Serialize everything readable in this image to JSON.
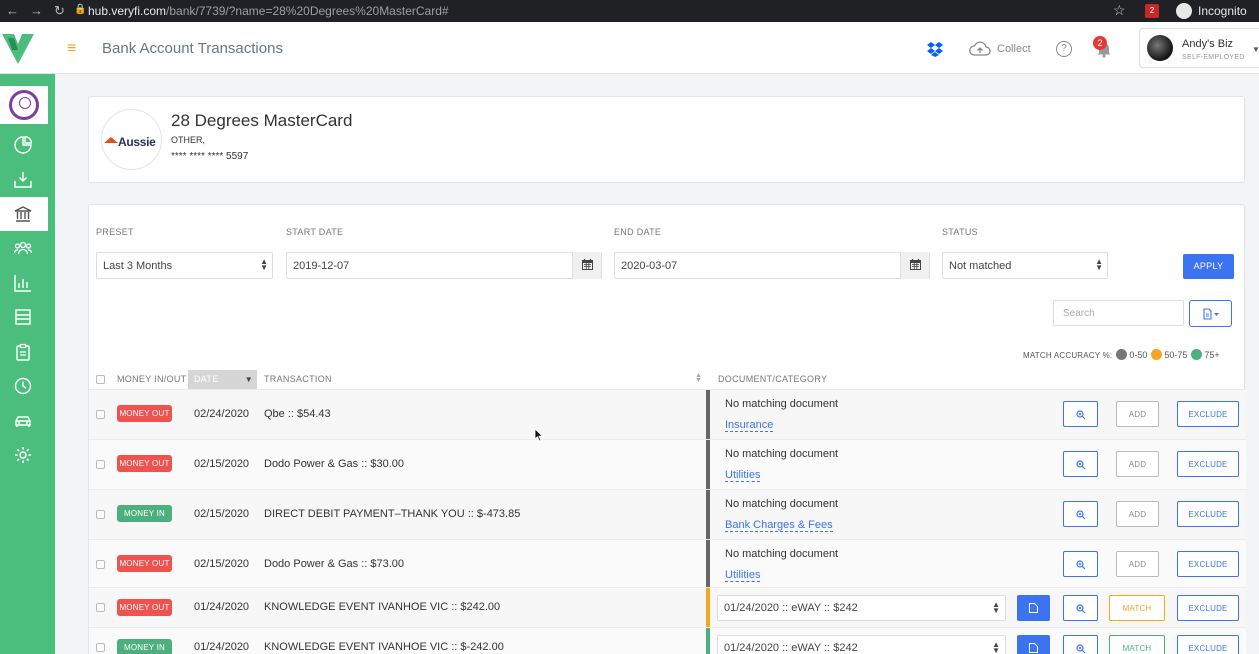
{
  "browser": {
    "url_host": "hub.veryfi.com",
    "url_path": "/bank/7739/?name=28%20Degrees%20MasterCard#",
    "incognito_label": "Incognito",
    "ext_badge": "2"
  },
  "header": {
    "title": "Bank Account Transactions",
    "collect_label": "Collect",
    "help_label": "?",
    "notification_count": "2",
    "user_name": "Andy's Biz",
    "user_role": "SELF-EMPLOYED"
  },
  "account": {
    "logo_text": "Aussie",
    "name": "28 Degrees MasterCard",
    "type": "OTHER,",
    "number": "**** **** **** 5597"
  },
  "filters": {
    "preset_label": "PRESET",
    "preset_value": "Last 3 Months",
    "start_label": "START DATE",
    "start_value": "2019-12-07",
    "end_label": "END DATE",
    "end_value": "2020-03-07",
    "status_label": "STATUS",
    "status_value": "Not matched",
    "apply_label": "APPLY",
    "search_placeholder": "Search"
  },
  "match_accuracy": {
    "label": "MATCH ACCURACY %:",
    "low": "0-50",
    "mid": "50-75",
    "high": "75+",
    "colors": {
      "low": "#777777",
      "mid": "#f5a623",
      "high": "#4caf7d"
    }
  },
  "table": {
    "headers": {
      "money": "MONEY IN/OUT",
      "date": "DATE",
      "transaction": "TRANSACTION",
      "document": "DOCUMENT/CATEGORY"
    },
    "rows": [
      {
        "badge": "MONEY OUT",
        "date": "02/24/2020",
        "desc": "Qbe :: $54.43",
        "doc": "No matching document",
        "category": "Insurance",
        "add": "ADD",
        "exclude": "EXCLUDE"
      },
      {
        "badge": "MONEY OUT",
        "date": "02/15/2020",
        "desc": "Dodo Power & Gas :: $30.00",
        "doc": "No matching document",
        "category": "Utilities",
        "add": "ADD",
        "exclude": "EXCLUDE"
      },
      {
        "badge": "MONEY IN",
        "date": "02/15/2020",
        "desc": "DIRECT DEBIT PAYMENT–THANK YOU :: $-473.85",
        "doc": "No matching document",
        "category": "Bank Charges & Fees",
        "add": "ADD",
        "exclude": "EXCLUDE"
      },
      {
        "badge": "MONEY OUT",
        "date": "02/15/2020",
        "desc": "Dodo Power & Gas :: $73.00",
        "doc": "No matching document",
        "category": "Utilities",
        "add": "ADD",
        "exclude": "EXCLUDE"
      },
      {
        "badge": "MONEY OUT",
        "date": "01/24/2020",
        "desc": "KNOWLEDGE EVENT IVANHOE VIC :: $242.00",
        "doc_select": "01/24/2020 :: eWAY :: $242",
        "match": "MATCH",
        "exclude": "EXCLUDE"
      },
      {
        "badge": "MONEY IN",
        "date": "01/24/2020",
        "desc": "KNOWLEDGE EVENT IVANHOE VIC :: $-242.00",
        "doc_select": "01/24/2020 :: eWAY :: $242",
        "match": "MATCH",
        "exclude": "EXCLUDE"
      }
    ]
  }
}
